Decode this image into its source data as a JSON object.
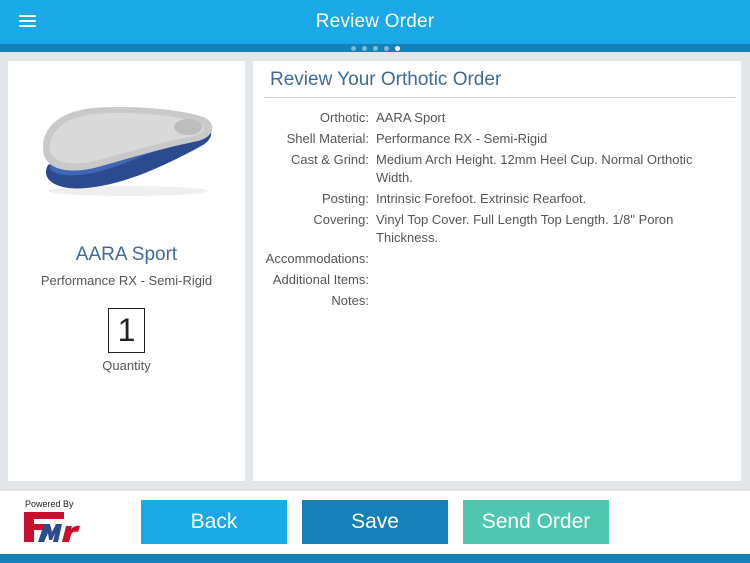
{
  "header": {
    "title": "Review Order",
    "menu_icon": "hamburger-menu-icon",
    "pager": {
      "total": 5,
      "active_index": 4
    }
  },
  "product": {
    "name": "AARA Sport",
    "material": "Performance RX - Semi-Rigid",
    "quantity": "1",
    "quantity_label": "Quantity",
    "image": "insole-image"
  },
  "review": {
    "title": "Review Your Orthotic Order",
    "rows": [
      {
        "label": "Orthotic:",
        "value": "AARA Sport"
      },
      {
        "label": "Shell Material:",
        "value": "Performance RX - Semi-Rigid"
      },
      {
        "label": "Cast & Grind:",
        "value": "Medium Arch Height. 12mm Heel Cup.  Normal Orthotic Width."
      },
      {
        "label": "Posting:",
        "value": "Intrinsic Forefoot. Extrinsic Rearfoot."
      },
      {
        "label": "Covering:",
        "value": "Vinyl Top Cover. Full Length Top Length. 1/8\" Poron Thickness."
      },
      {
        "label": "Accommodations:",
        "value": ""
      },
      {
        "label": "Additional Items:",
        "value": ""
      },
      {
        "label": "Notes:",
        "value": ""
      }
    ]
  },
  "footer": {
    "powered_by": "Powered By",
    "logo_icon": "fmr-logo",
    "back_label": "Back",
    "save_label": "Save",
    "send_label": "Send Order"
  },
  "colors": {
    "header": "#1aa8e6",
    "header_dark": "#1581b8",
    "accent_text": "#3d6b9a",
    "send_button": "#4fc7b0",
    "background": "#e4e7ea"
  }
}
